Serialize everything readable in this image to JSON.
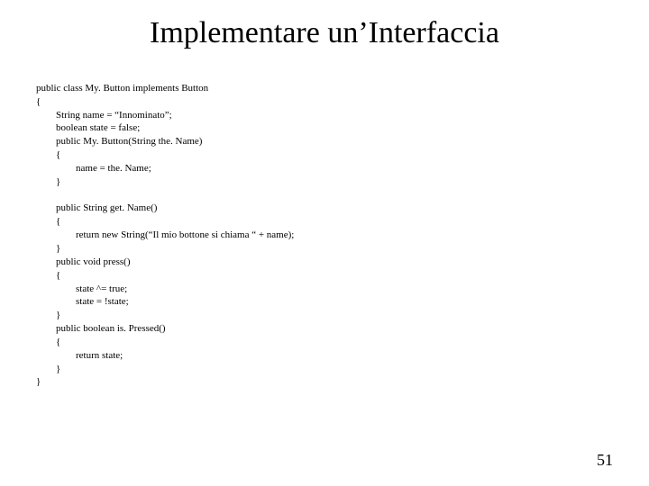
{
  "title": "Implementare un’Interfaccia",
  "page_number": "51",
  "code": {
    "l1": "public class My. Button implements Button",
    "l2": "{",
    "l3": "String name = “Innominato”;",
    "l4": "boolean state = false;",
    "l5": "public My. Button(String the. Name)",
    "l6": "{",
    "l7": "name = the. Name;",
    "l8": "}",
    "l9": "public String get. Name()",
    "l10": "{",
    "l11": "return new String(“Il mio bottone si chiama “ + name);",
    "l12": "}",
    "l13": "public void press()",
    "l14": "{",
    "l15": "state ^= true;",
    "l16": "state = !state;",
    "l17": "}",
    "l18": "public boolean is. Pressed()",
    "l19": "{",
    "l20": "return state;",
    "l21": "}",
    "l22": "}"
  }
}
